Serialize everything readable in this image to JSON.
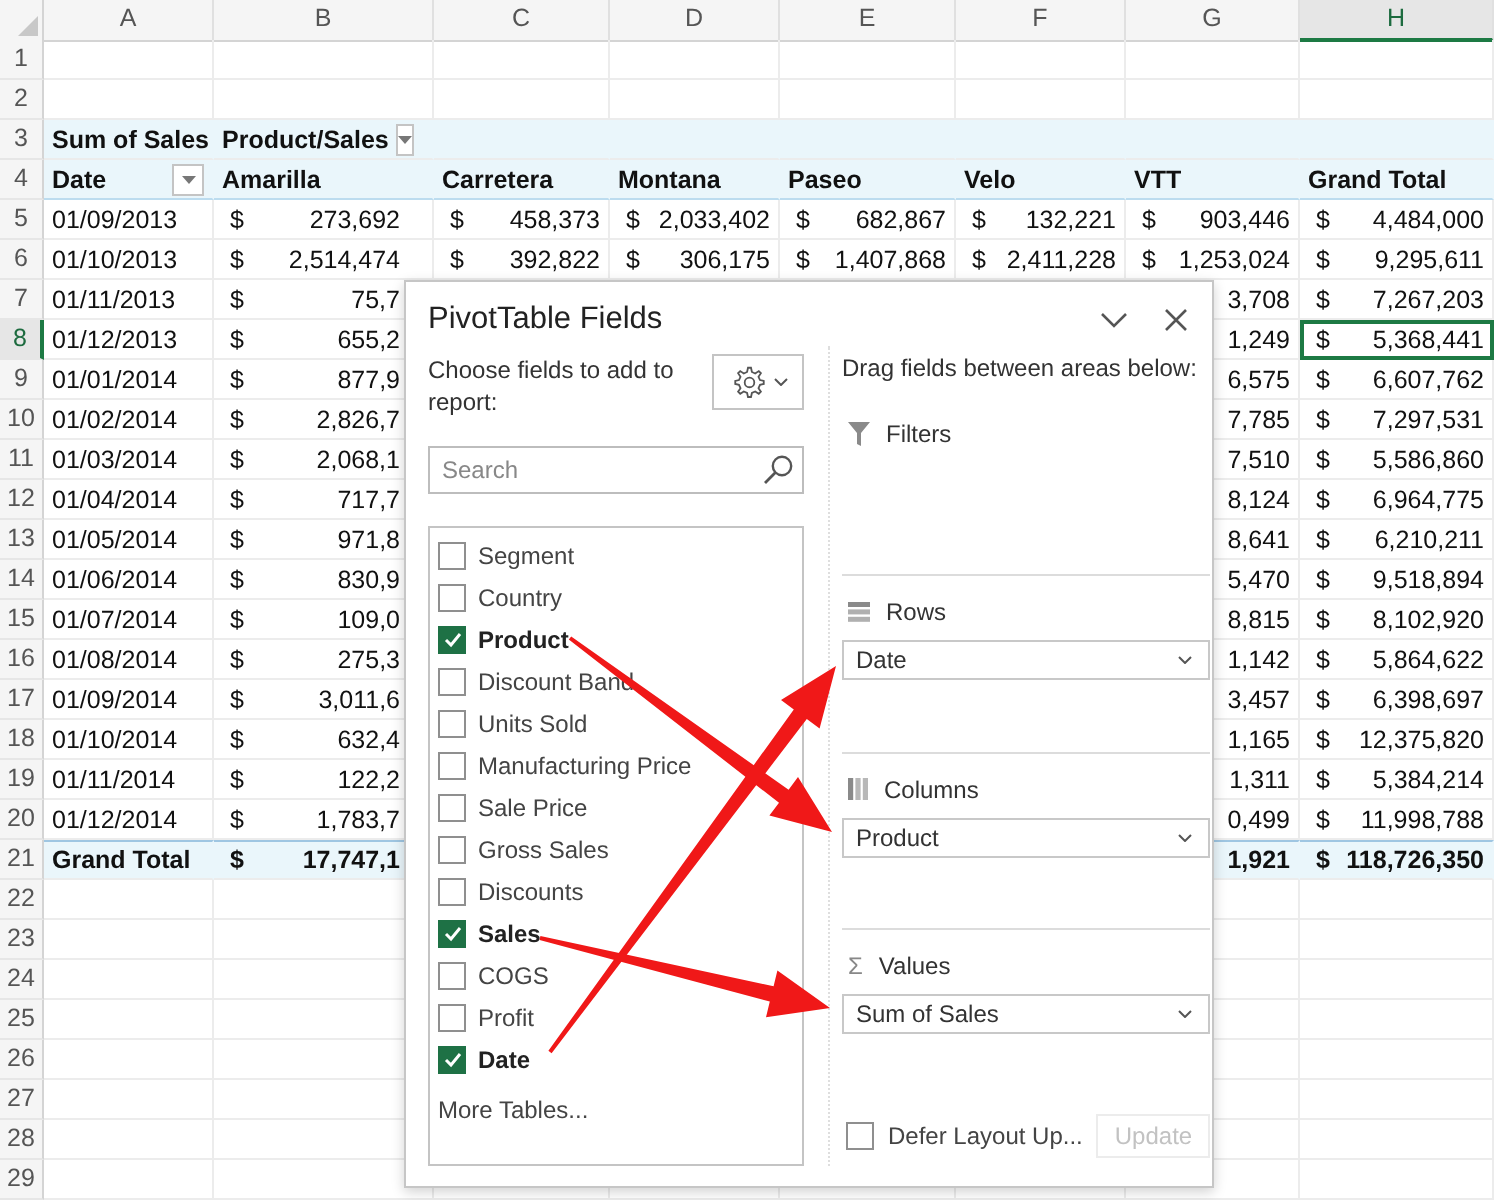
{
  "columns": [
    {
      "label": "A",
      "selected": false
    },
    {
      "label": "B",
      "selected": false
    },
    {
      "label": "C",
      "selected": false
    },
    {
      "label": "D",
      "selected": false
    },
    {
      "label": "E",
      "selected": false
    },
    {
      "label": "F",
      "selected": false
    },
    {
      "label": "G",
      "selected": false
    },
    {
      "label": "H",
      "selected": true
    }
  ],
  "rows": [
    {
      "number": "1",
      "selected": false,
      "kind": "empty"
    },
    {
      "number": "2",
      "selected": false,
      "kind": "empty"
    },
    {
      "number": "3",
      "selected": false,
      "kind": "header",
      "cells": [
        {
          "text": "Sum of Sales"
        },
        {
          "text": "Product/Sales",
          "filter": true
        },
        null,
        null,
        null,
        null,
        null,
        null
      ]
    },
    {
      "number": "4",
      "selected": false,
      "kind": "header",
      "cells": [
        {
          "text": "Date",
          "filter": true
        },
        {
          "text": "Amarilla"
        },
        {
          "text": "Carretera"
        },
        {
          "text": "Montana"
        },
        {
          "text": "Paseo"
        },
        {
          "text": "Velo"
        },
        {
          "text": "VTT"
        },
        {
          "text": "Grand Total"
        }
      ]
    },
    {
      "number": "5",
      "selected": false,
      "kind": "data",
      "cells": [
        {
          "text": "01/09/2013"
        },
        {
          "currency": "$",
          "amount": "273,692"
        },
        {
          "currency": "$",
          "amount": "458,373"
        },
        {
          "currency": "$",
          "amount": "2,033,402"
        },
        {
          "currency": "$",
          "amount": "682,867"
        },
        {
          "currency": "$",
          "amount": "132,221"
        },
        {
          "currency": "$",
          "amount": "903,446"
        },
        {
          "currency": "$",
          "amount": "4,484,000"
        }
      ]
    },
    {
      "number": "6",
      "selected": false,
      "kind": "data",
      "cells": [
        {
          "text": "01/10/2013"
        },
        {
          "currency": "$",
          "amount": "2,514,474"
        },
        {
          "currency": "$",
          "amount": "392,822"
        },
        {
          "currency": "$",
          "amount": "306,175"
        },
        {
          "currency": "$",
          "amount": "1,407,868"
        },
        {
          "currency": "$",
          "amount": "2,411,228"
        },
        {
          "currency": "$",
          "amount": "1,253,024"
        },
        {
          "currency": "$",
          "amount": "9,295,611"
        }
      ]
    },
    {
      "number": "7",
      "selected": false,
      "kind": "data",
      "cells": [
        {
          "text": "01/11/2013"
        },
        {
          "currency": "$",
          "amount": "75,7"
        },
        null,
        null,
        null,
        null,
        {
          "amount": "3,708"
        },
        {
          "currency": "$",
          "amount": "7,267,203"
        }
      ]
    },
    {
      "number": "8",
      "selected": true,
      "kind": "data",
      "cells": [
        {
          "text": "01/12/2013"
        },
        {
          "currency": "$",
          "amount": "655,2"
        },
        null,
        null,
        null,
        null,
        {
          "amount": "1,249"
        },
        {
          "currency": "$",
          "amount": "5,368,441"
        }
      ]
    },
    {
      "number": "9",
      "selected": false,
      "kind": "data",
      "cells": [
        {
          "text": "01/01/2014"
        },
        {
          "currency": "$",
          "amount": "877,9"
        },
        null,
        null,
        null,
        null,
        {
          "amount": "6,575"
        },
        {
          "currency": "$",
          "amount": "6,607,762"
        }
      ]
    },
    {
      "number": "10",
      "selected": false,
      "kind": "data",
      "cells": [
        {
          "text": "01/02/2014"
        },
        {
          "currency": "$",
          "amount": "2,826,7"
        },
        null,
        null,
        null,
        null,
        {
          "amount": "7,785"
        },
        {
          "currency": "$",
          "amount": "7,297,531"
        }
      ]
    },
    {
      "number": "11",
      "selected": false,
      "kind": "data",
      "cells": [
        {
          "text": "01/03/2014"
        },
        {
          "currency": "$",
          "amount": "2,068,1"
        },
        null,
        null,
        null,
        null,
        {
          "amount": "7,510"
        },
        {
          "currency": "$",
          "amount": "5,586,860"
        }
      ]
    },
    {
      "number": "12",
      "selected": false,
      "kind": "data",
      "cells": [
        {
          "text": "01/04/2014"
        },
        {
          "currency": "$",
          "amount": "717,7"
        },
        null,
        null,
        null,
        null,
        {
          "amount": "8,124"
        },
        {
          "currency": "$",
          "amount": "6,964,775"
        }
      ]
    },
    {
      "number": "13",
      "selected": false,
      "kind": "data",
      "cells": [
        {
          "text": "01/05/2014"
        },
        {
          "currency": "$",
          "amount": "971,8"
        },
        null,
        null,
        null,
        null,
        {
          "amount": "8,641"
        },
        {
          "currency": "$",
          "amount": "6,210,211"
        }
      ]
    },
    {
      "number": "14",
      "selected": false,
      "kind": "data",
      "cells": [
        {
          "text": "01/06/2014"
        },
        {
          "currency": "$",
          "amount": "830,9"
        },
        null,
        null,
        null,
        null,
        {
          "amount": "5,470"
        },
        {
          "currency": "$",
          "amount": "9,518,894"
        }
      ]
    },
    {
      "number": "15",
      "selected": false,
      "kind": "data",
      "cells": [
        {
          "text": "01/07/2014"
        },
        {
          "currency": "$",
          "amount": "109,0"
        },
        null,
        null,
        null,
        null,
        {
          "amount": "8,815"
        },
        {
          "currency": "$",
          "amount": "8,102,920"
        }
      ]
    },
    {
      "number": "16",
      "selected": false,
      "kind": "data",
      "cells": [
        {
          "text": "01/08/2014"
        },
        {
          "currency": "$",
          "amount": "275,3"
        },
        null,
        null,
        null,
        null,
        {
          "amount": "1,142"
        },
        {
          "currency": "$",
          "amount": "5,864,622"
        }
      ]
    },
    {
      "number": "17",
      "selected": false,
      "kind": "data",
      "cells": [
        {
          "text": "01/09/2014"
        },
        {
          "currency": "$",
          "amount": "3,011,6"
        },
        null,
        null,
        null,
        null,
        {
          "amount": "3,457"
        },
        {
          "currency": "$",
          "amount": "6,398,697"
        }
      ]
    },
    {
      "number": "18",
      "selected": false,
      "kind": "data",
      "cells": [
        {
          "text": "01/10/2014"
        },
        {
          "currency": "$",
          "amount": "632,4"
        },
        null,
        null,
        null,
        null,
        {
          "amount": "1,165"
        },
        {
          "currency": "$",
          "amount": "12,375,820"
        }
      ]
    },
    {
      "number": "19",
      "selected": false,
      "kind": "data",
      "cells": [
        {
          "text": "01/11/2014"
        },
        {
          "currency": "$",
          "amount": "122,2"
        },
        null,
        null,
        null,
        null,
        {
          "amount": "1,311"
        },
        {
          "currency": "$",
          "amount": "5,384,214"
        }
      ]
    },
    {
      "number": "20",
      "selected": false,
      "kind": "data",
      "cells": [
        {
          "text": "01/12/2014"
        },
        {
          "currency": "$",
          "amount": "1,783,7"
        },
        null,
        null,
        null,
        null,
        {
          "amount": "0,499"
        },
        {
          "currency": "$",
          "amount": "11,998,788"
        }
      ]
    },
    {
      "number": "21",
      "selected": false,
      "kind": "total",
      "cells": [
        {
          "text": "Grand Total"
        },
        {
          "currency": "$",
          "amount": "17,747,1"
        },
        null,
        null,
        null,
        null,
        {
          "amount": "1,921"
        },
        {
          "currency": "$",
          "amount": "118,726,350"
        }
      ]
    },
    {
      "number": "22",
      "selected": false,
      "kind": "empty"
    },
    {
      "number": "23",
      "selected": false,
      "kind": "empty"
    },
    {
      "number": "24",
      "selected": false,
      "kind": "empty"
    },
    {
      "number": "25",
      "selected": false,
      "kind": "empty"
    },
    {
      "number": "26",
      "selected": false,
      "kind": "empty"
    },
    {
      "number": "27",
      "selected": false,
      "kind": "empty"
    },
    {
      "number": "28",
      "selected": false,
      "kind": "empty"
    },
    {
      "number": "29",
      "selected": false,
      "kind": "empty"
    }
  ],
  "pivot_panel": {
    "title": "PivotTable Fields",
    "instruction": "Choose fields to add to report:",
    "search": {
      "placeholder": "Search"
    },
    "fields": [
      {
        "label": "Segment",
        "checked": false
      },
      {
        "label": "Country",
        "checked": false
      },
      {
        "label": "Product",
        "checked": true
      },
      {
        "label": "Discount Band",
        "checked": false
      },
      {
        "label": "Units Sold",
        "checked": false
      },
      {
        "label": "Manufacturing Price",
        "checked": false
      },
      {
        "label": "Sale Price",
        "checked": false
      },
      {
        "label": "Gross Sales",
        "checked": false
      },
      {
        "label": "Discounts",
        "checked": false
      },
      {
        "label": "Sales",
        "checked": true
      },
      {
        "label": "COGS",
        "checked": false
      },
      {
        "label": "Profit",
        "checked": false
      },
      {
        "label": "Date",
        "checked": true
      }
    ],
    "more_link": "More Tables...",
    "areas_hint": "Drag fields between areas below:",
    "areas": [
      {
        "kind": "filters",
        "label": "Filters"
      },
      {
        "kind": "rows",
        "label": "Rows",
        "items": [
          "Date"
        ]
      },
      {
        "kind": "columns",
        "label": "Columns",
        "items": [
          "Product"
        ]
      },
      {
        "kind": "values",
        "label": "Values",
        "symbol": "Σ",
        "items": [
          "Sum of Sales"
        ]
      }
    ],
    "defer": {
      "label": "Defer Layout Up...",
      "checked": false
    },
    "update_button": {
      "label": "Update",
      "disabled": true
    }
  }
}
